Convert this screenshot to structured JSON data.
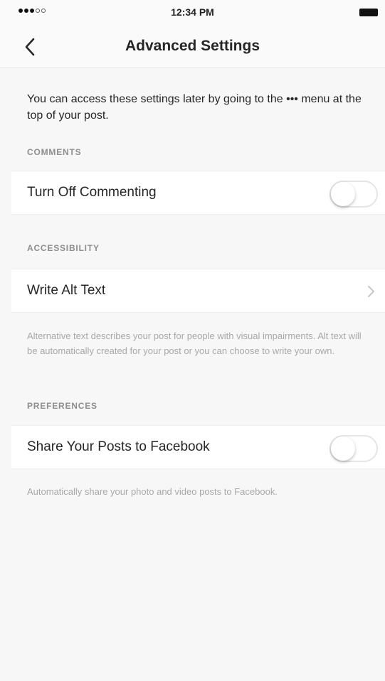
{
  "status_bar": {
    "time": "12:34 PM",
    "signal_icon": "signal-dots-icon",
    "battery_icon": "battery-icon"
  },
  "nav": {
    "title": "Advanced Settings",
    "back_icon": "chevron-left-icon"
  },
  "intro_text": "You can access these settings later by going to the ••• menu at the top of your post.",
  "sections": {
    "comments": {
      "header": "COMMENTS",
      "toggle_label": "Turn Off Commenting",
      "toggle_on": false
    },
    "accessibility": {
      "header": "ACCESSIBILITY",
      "row_label": "Write Alt Text",
      "chevron_icon": "chevron-right-icon",
      "footnote": "Alternative text describes your post for people with visual impairments. Alt text will be automatically created for your post or you can choose to write your own."
    },
    "preferences": {
      "header": "PREFERENCES",
      "toggle_label": "Share Your Posts to Facebook",
      "toggle_on": false,
      "footnote": "Automatically share your photo and video posts to Facebook."
    }
  },
  "colors": {
    "background": "#f7f7f7",
    "row_background": "#ffffff",
    "primary_text": "#262626",
    "secondary_text": "#a8a8a8"
  }
}
